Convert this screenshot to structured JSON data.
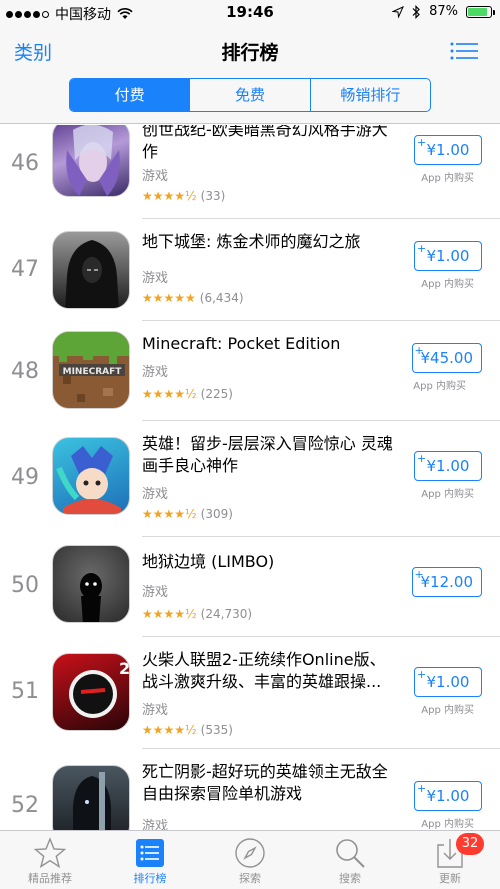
{
  "status": {
    "carrier": "中国移动",
    "time": "19:46",
    "battery": "87%",
    "battery_level": 0.87
  },
  "nav": {
    "back_label": "类别",
    "title": "排行榜",
    "segments": [
      "付费",
      "免费",
      "畅销排行"
    ],
    "active_segment": 0
  },
  "apps": [
    {
      "rank": "46",
      "name": "创世战纪-欧美暗黑奇幻风格手游大作",
      "category": "游戏",
      "stars": "★★★★½",
      "rating_count": "(33)",
      "price": "¥1.00",
      "plus": "+",
      "iap": "App 内购买",
      "icon": "fantasy-hero-icon"
    },
    {
      "rank": "47",
      "name": "地下城堡: 炼金术师的魔幻之旅",
      "category": "游戏",
      "stars": "★★★★★",
      "rating_count": "(6,434)",
      "price": "¥1.00",
      "plus": "+",
      "iap": "App 内购买",
      "icon": "hooded-figure-icon"
    },
    {
      "rank": "48",
      "name": "Minecraft: Pocket Edition",
      "category": "游戏",
      "stars": "★★★★½",
      "rating_count": "(225)",
      "price": "¥45.00",
      "plus": "+",
      "iap": "App 内购买",
      "icon": "minecraft-grass-block-icon"
    },
    {
      "rank": "49",
      "name": "英雄！留步-层层深入冒险惊心 灵魂画手良心神作",
      "category": "游戏",
      "stars": "★★★★½",
      "rating_count": "(309)",
      "price": "¥1.00",
      "plus": "+",
      "iap": "App 内购买",
      "icon": "cartoon-hero-icon"
    },
    {
      "rank": "50",
      "name": "地狱边境 (LIMBO)",
      "category": "游戏",
      "stars": "★★★★½",
      "rating_count": "(24,730)",
      "price": "¥12.00",
      "plus": "+",
      "iap": "",
      "icon": "limbo-silhouette-icon"
    },
    {
      "rank": "51",
      "name": "火柴人联盟2-正统续作Online版、战斗激爽升级、丰富的英雄跟操...",
      "category": "游戏",
      "stars": "★★★★½",
      "rating_count": "(535)",
      "price": "¥1.00",
      "plus": "+",
      "iap": "App 内购买",
      "icon": "stickman-icon"
    },
    {
      "rank": "52",
      "name": "死亡阴影-超好玩的英雄领主无敌全自由探索冒险单机游戏",
      "category": "游戏",
      "stars": "",
      "rating_count": "",
      "price": "¥1.00",
      "plus": "+",
      "iap": "App 内购买",
      "icon": "dark-knight-icon"
    }
  ],
  "tabs": [
    {
      "label": "精品推荐",
      "icon": "star-icon"
    },
    {
      "label": "排行榜",
      "icon": "list-icon",
      "active": true
    },
    {
      "label": "探索",
      "icon": "compass-icon"
    },
    {
      "label": "搜索",
      "icon": "search-icon"
    },
    {
      "label": "更新",
      "icon": "download-icon",
      "badge": "32"
    }
  ],
  "colors": {
    "accent": "#1a82fb",
    "star": "#f2a31f",
    "badge": "#ff3b30"
  }
}
